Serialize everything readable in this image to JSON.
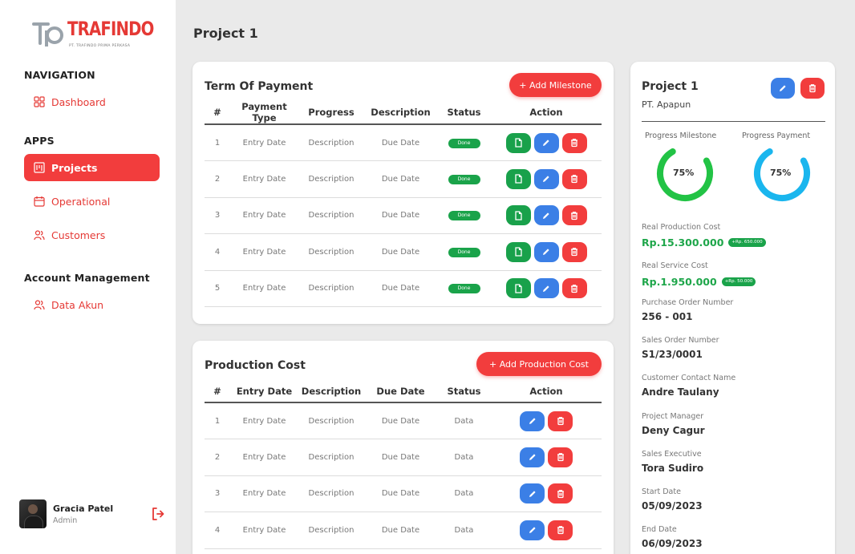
{
  "brand": {
    "name": "TRAFINDO",
    "tagline": "PT. TRAFINDO PRIMA PERKASA",
    "accent_color": "#f23d3d"
  },
  "sidebar": {
    "sections": {
      "navigation": "NAVIGATION",
      "apps": "APPS",
      "account": "Account Management"
    },
    "items": {
      "dashboard": "Dashboard",
      "projects": "Projects",
      "operational": "Operational",
      "customers": "Customers",
      "data_akun": "Data Akun"
    },
    "active_item": "projects",
    "user": {
      "name": "Gracia Patel",
      "role": "Admin"
    }
  },
  "page": {
    "title": "Project 1"
  },
  "term_of_payment": {
    "title": "Term Of Payment",
    "add_button": "+ Add Milestone",
    "columns": [
      "#",
      "Payment Type",
      "Progress",
      "Description",
      "Status",
      "Action"
    ],
    "rows": [
      {
        "no": "1",
        "payment_type": "Entry Date",
        "progress": "Description",
        "description": "Due Date",
        "status": "Done"
      },
      {
        "no": "2",
        "payment_type": "Entry Date",
        "progress": "Description",
        "description": "Due Date",
        "status": "Done"
      },
      {
        "no": "3",
        "payment_type": "Entry Date",
        "progress": "Description",
        "description": "Due Date",
        "status": "Done"
      },
      {
        "no": "4",
        "payment_type": "Entry Date",
        "progress": "Description",
        "description": "Due Date",
        "status": "Done"
      },
      {
        "no": "5",
        "payment_type": "Entry Date",
        "progress": "Description",
        "description": "Due Date",
        "status": "Done"
      }
    ]
  },
  "production_cost": {
    "title": "Production Cost",
    "add_button": "+ Add Production Cost",
    "columns": [
      "#",
      "Entry Date",
      "Description",
      "Due Date",
      "Status",
      "Action"
    ],
    "rows": [
      {
        "no": "1",
        "entry_date": "Entry Date",
        "description": "Description",
        "due_date": "Due Date",
        "status": "Data"
      },
      {
        "no": "2",
        "entry_date": "Entry Date",
        "description": "Description",
        "due_date": "Due Date",
        "status": "Data"
      },
      {
        "no": "3",
        "entry_date": "Entry Date",
        "description": "Description",
        "due_date": "Due Date",
        "status": "Data"
      },
      {
        "no": "4",
        "entry_date": "Entry Date",
        "description": "Description",
        "due_date": "Due Date",
        "status": "Data"
      }
    ]
  },
  "detail": {
    "title": "Project 1",
    "client": "PT. Apapun",
    "progress_milestone": {
      "label": "Progress Milestone",
      "percent": 75,
      "text": "75%",
      "color": "#22c345"
    },
    "progress_payment": {
      "label": "Progress Payment",
      "percent": 75,
      "text": "75%",
      "color": "#1ab6ee"
    },
    "real_production_cost": {
      "label": "Real Production Cost",
      "value": "Rp.15.300.000",
      "badge": "+Rp. 650.000"
    },
    "real_service_cost": {
      "label": "Real Service Cost",
      "value": "Rp.1.950.000",
      "badge": "+Rp. 50.000"
    },
    "fields": [
      {
        "label": "Purchase Order Number",
        "value": "256 - 001"
      },
      {
        "label": "Sales Order Number",
        "value": "S1/23/0001"
      },
      {
        "label": "Customer Contact Name",
        "value": "Andre Taulany"
      },
      {
        "label": "Project Manager",
        "value": "Deny Cagur"
      },
      {
        "label": "Sales Executive",
        "value": "Tora Sudiro"
      },
      {
        "label": "Start Date",
        "value": "05/09/2023"
      },
      {
        "label": "End Date",
        "value": "06/09/2023"
      }
    ]
  }
}
